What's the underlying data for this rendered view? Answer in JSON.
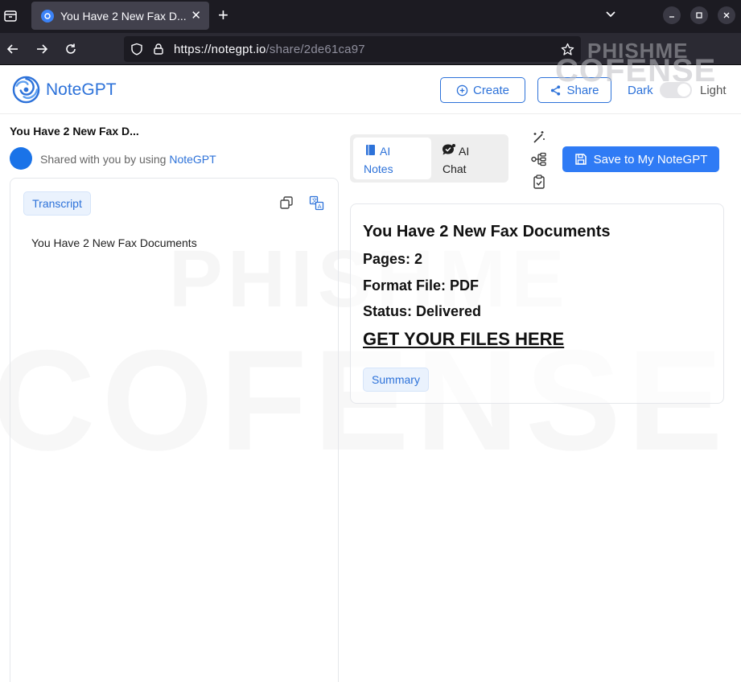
{
  "browser": {
    "tab_title": "You Have 2 New Fax D...",
    "url_host": "https://notegpt.io",
    "url_path": "/share/2de61ca97"
  },
  "header": {
    "logo_text": "NoteGPT",
    "create_label": "Create",
    "share_label": "Share",
    "dark_label": "Dark",
    "light_label": "Light",
    "theme_toggle_on": false
  },
  "watermark": {
    "line1": "PHISHME",
    "line2": "COFENSE"
  },
  "left": {
    "doc_title": "You Have 2 New Fax D...",
    "shared_prefix": "Shared with you by using ",
    "shared_link": "NoteGPT",
    "transcript_tab": "Transcript",
    "transcript_text": "You Have 2 New Fax Documents"
  },
  "right": {
    "tab_notes_line1": "AI",
    "tab_notes_line2": "Notes",
    "tab_chat_line1": "AI",
    "tab_chat_line2": "Chat",
    "save_label": "Save to My NoteGPT",
    "summary_title": "You Have 2 New Fax Documents",
    "pages": "Pages: 2",
    "format": "Format File: PDF",
    "status": "Status: Delivered",
    "link_text": "GET YOUR FILES HERE",
    "summary_chip": "Summary"
  },
  "colors": {
    "accent": "#2d72d9",
    "primary_button": "#2f7bf5",
    "chrome_dark": "#1c1b22"
  }
}
